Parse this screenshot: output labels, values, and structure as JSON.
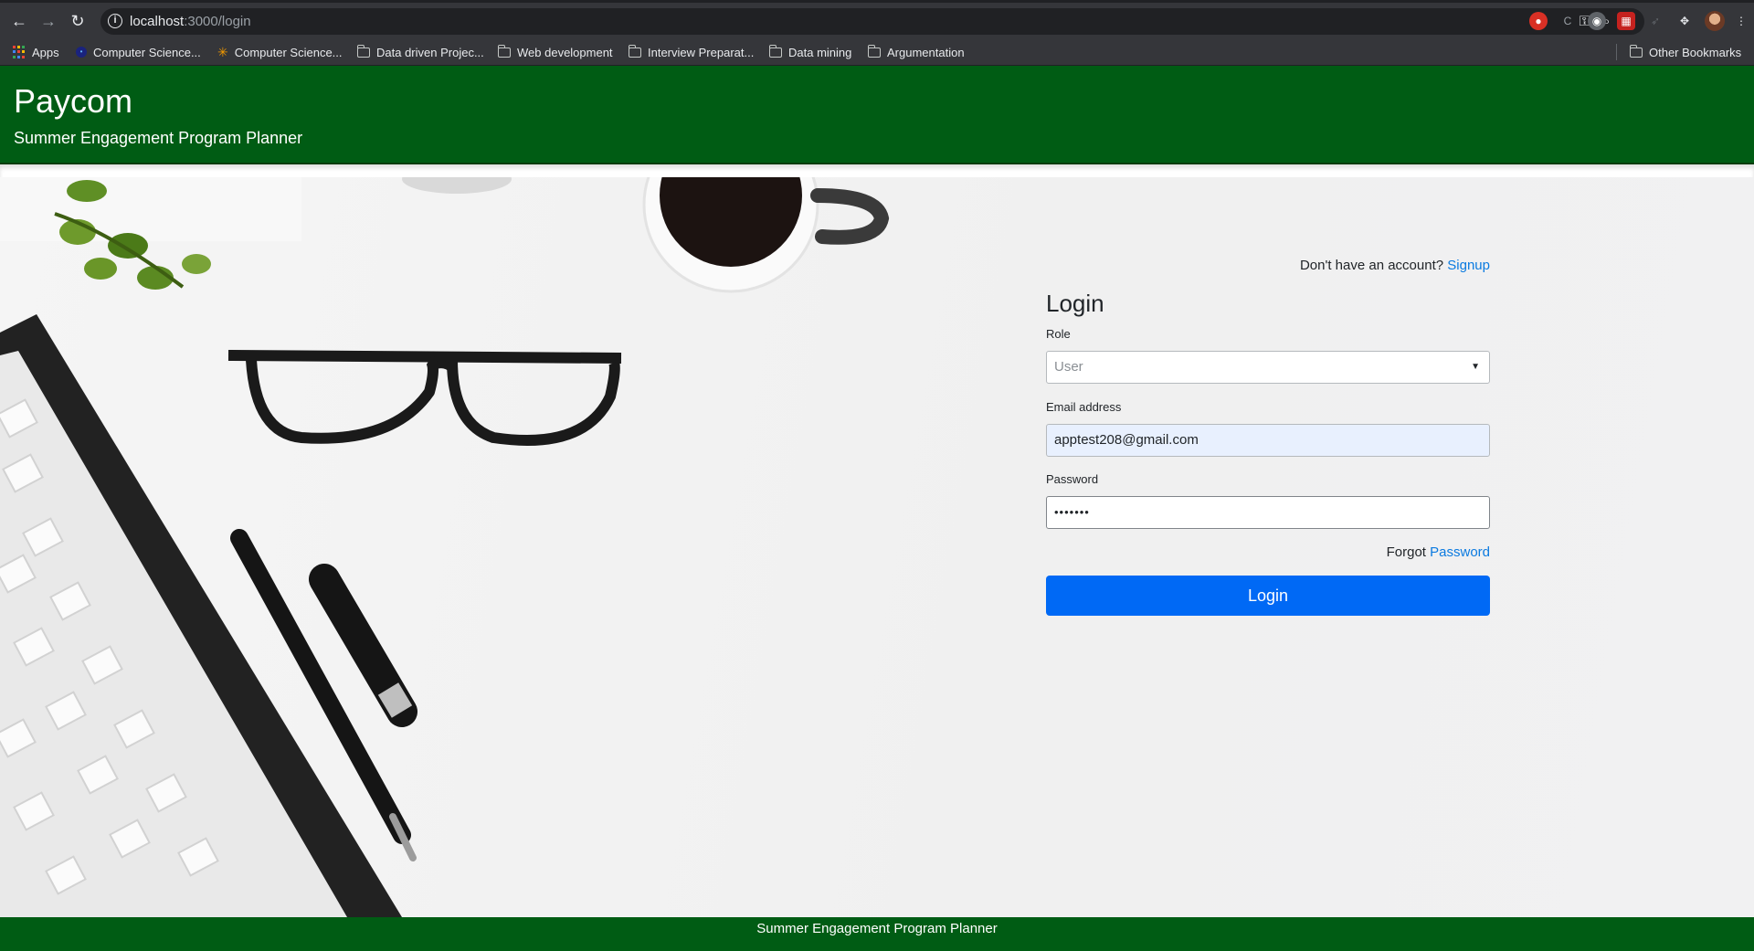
{
  "browser": {
    "url_host": "localhost",
    "url_path": ":3000/login",
    "bookmarks": [
      {
        "label": "Apps",
        "icon": "apps-grid-icon"
      },
      {
        "label": "Computer Science...",
        "icon": "site-favicon-icon"
      },
      {
        "label": "Computer Science...",
        "icon": "star-favicon-icon"
      },
      {
        "label": "Data driven Projec...",
        "icon": "folder-icon"
      },
      {
        "label": "Web development",
        "icon": "folder-icon"
      },
      {
        "label": "Interview Preparat...",
        "icon": "folder-icon"
      },
      {
        "label": "Data mining",
        "icon": "folder-icon"
      },
      {
        "label": "Argumentation",
        "icon": "folder-icon"
      }
    ],
    "other_bookmarks": "Other Bookmarks"
  },
  "header": {
    "title": "Paycom",
    "subtitle": "Summer Engagement Program Planner",
    "color": "#005c14"
  },
  "login": {
    "signup_prompt": "Don't have an account?",
    "signup_link": "Signup",
    "heading": "Login",
    "role_label": "Role",
    "role_value": "User",
    "email_label": "Email address",
    "email_value": "apptest208@gmail.com",
    "password_label": "Password",
    "password_value": "•••••••",
    "forgot_text": "Forgot",
    "forgot_link": "Password",
    "submit_label": "Login",
    "button_color": "#0069f5",
    "link_color": "#0b7ae0"
  },
  "footer": {
    "text": "Summer Engagement Program Planner"
  }
}
